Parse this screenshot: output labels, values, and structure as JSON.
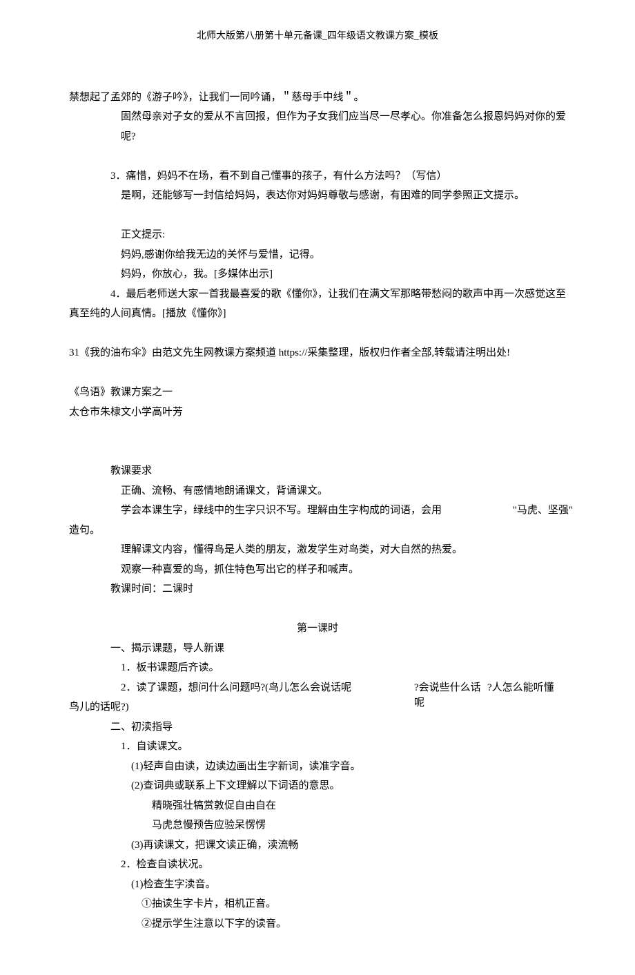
{
  "header": {
    "title": "北师大版第八册第十单元备课_四年级语文教课方案_模板"
  },
  "body": {
    "p1": "禁想起了孟郊的《游子吟》，让我们一同吟诵，＂慈母手中线＂。",
    "p2": "固然母亲对子女的爱从不言回报，但作为子女我们应当尽一尽孝心。你准备怎么报恩妈妈对你的爱呢?",
    "p3a": "3．痛惜，妈妈不在场，看不到自己懂事的孩子，有什么方法吗？（写信）",
    "p3b": "是啊，还能够写一封信给妈妈，表达你对妈妈尊敬与感谢，有困难的同学参照正文提示。",
    "p4": "正文提示:",
    "p5": "妈妈,感谢你给我无边的关怀与爱惜，记得。",
    "p6": "妈妈，你放心，我。[多媒体出示]",
    "p7": "4．最后老师送大家一首我最喜爱的歌《懂你》，让我们在满文军那略带愁闷的歌声中再一次感觉这至真至纯的人间真情。[播放《懂你》]",
    "p8": "31《我的油布伞》由范文先生网教课方案频道 https://采集整理，版权归作者全部,转载请注明出处!",
    "p9": "《鸟语》教课方案之一",
    "p10": "太仓市朱棣文小学高叶芳",
    "p11": "教课要求",
    "p12": "正确、流畅、有感情地朗诵课文，背诵课文。",
    "p13a": "学会本课生字，绿线中的生字只识不写。理解由生字构成的词语，会用",
    "p13b": "\"马虎、坚强\"",
    "p13c": "造句。",
    "p14": "理解课文内容，懂得鸟是人类的朋友，激发学生对鸟类，对大自然的热爱。",
    "p15": "观察一种喜爱的鸟，抓住特色写出它的样子和喊声。",
    "p16": "教课时间：二课时",
    "p17": "第一课时",
    "p18": "一、揭示课题，导人新课",
    "p19": "1．板书课题后齐读。",
    "p20a": "2．读了课题，想问什么问题吗?(鸟儿怎么会说话呢",
    "p20b": "?会说些什么话",
    "p20c": "?人怎么能听懂",
    "p20d": "呢",
    "p20e": "鸟儿的话呢?)",
    "p21": "二、初渎指导",
    "p22": "1．自读课文。",
    "p23": "(1)轻声自由读，边读边画出生字新词，读准字音。",
    "p24": "(2)查词典或联系上下文理解以下词语的意思。",
    "p25": "精晓强壮犒赏敦促自由自在",
    "p26": "马虎怠慢预告应验呆愣愣",
    "p27": "(3)再读课文，把课文读正确，渎流畅",
    "p28": "2．检查自读状况。",
    "p29": "(1)检查生字渎音。",
    "p30": "①抽读生字卡片，相机正音。",
    "p31": "②提示学生注意以下字的读音。"
  }
}
